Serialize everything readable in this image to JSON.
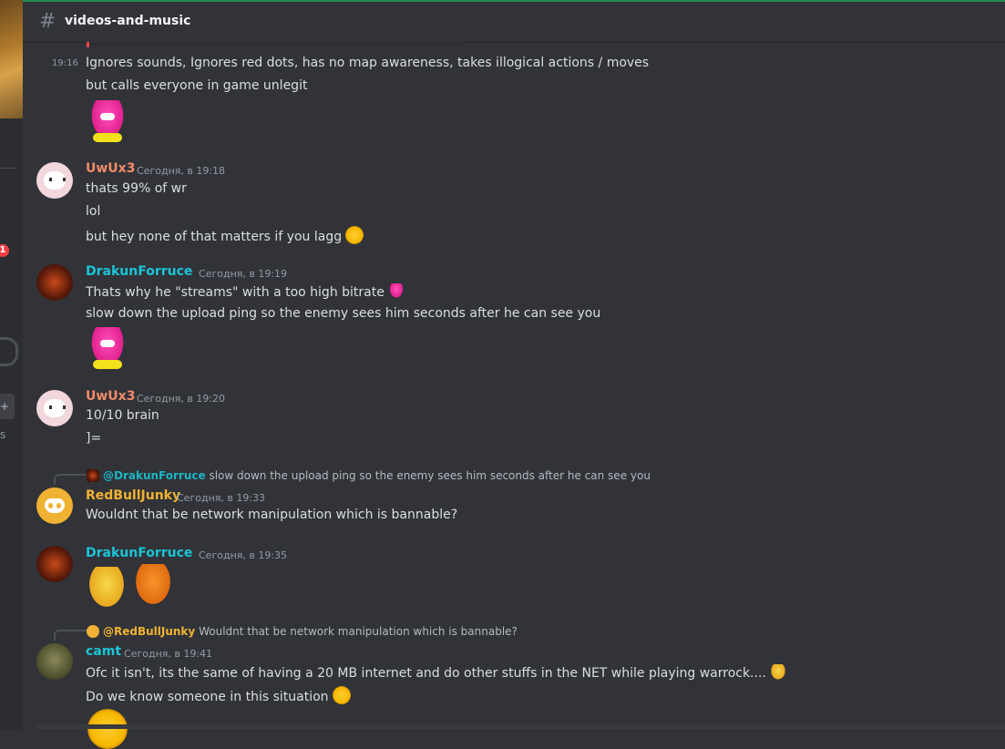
{
  "channel": {
    "name": "videos-and-music"
  },
  "server": {
    "badge": "1",
    "sidebar_letter": "s"
  },
  "colors": {
    "uwu": "#f28c6a",
    "drak": "#1bc4d6",
    "red": "#f0b232",
    "camt": "#1bc4d6"
  },
  "messages": {
    "m0": {
      "time": "19:16",
      "line1": "Ignores sounds, Ignores red dots, has no map awareness, takes illogical actions / moves",
      "line2": "but calls everyone in game unlegit"
    },
    "m1": {
      "author": "UwUx3",
      "date": "Сегодня, в 19:18",
      "line1": "thats 99% of wr",
      "line2": "lol",
      "line3": "but hey none of that matters if you lagg"
    },
    "m2": {
      "author": "DrakunForruce",
      "date": "Сегодня, в 19:19",
      "line1": "Thats why he \"streams\" with a too high bitrate",
      "line2": "slow down the upload ping so the enemy sees him seconds after he can see you"
    },
    "m3": {
      "author": "UwUx3",
      "date": "Сегодня, в 19:20",
      "line1": "10/10 brain",
      "line2": "]="
    },
    "m4": {
      "reply_name": "@DrakunForruce",
      "reply_text": "slow down the upload ping so the enemy sees him seconds after he can see you",
      "author": "RedBullJunky",
      "date": "Сегодня, в 19:33",
      "line1": "Wouldnt that be network manipulation which is bannable?"
    },
    "m5": {
      "author": "DrakunForruce",
      "date": "Сегодня, в 19:35"
    },
    "m6": {
      "reply_name": "@RedBullJunky",
      "reply_text": "Wouldnt that be network manipulation which is bannable?",
      "author": "camt",
      "date": "Сегодня, в 19:41",
      "line1": "Ofc it isn't, its the same of having a 20 MB internet and do other stuffs in the NET while playing warrock....",
      "line2": "Do we know someone in this situation"
    }
  }
}
